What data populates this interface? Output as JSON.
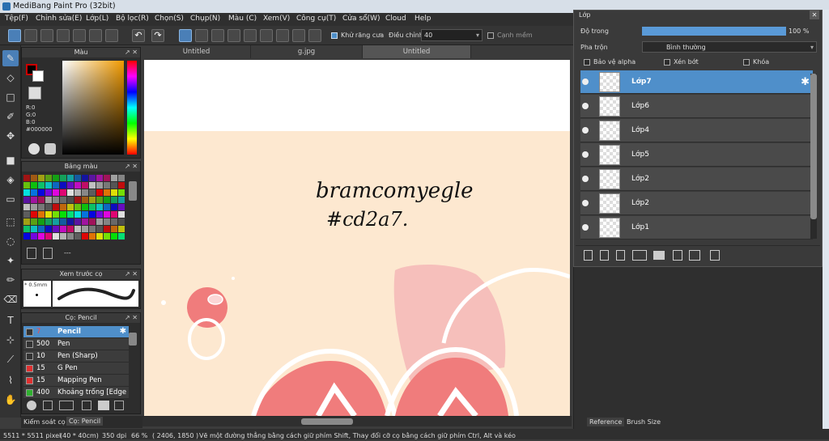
{
  "window": {
    "title": "MediBang Paint Pro (32bit)"
  },
  "menu": [
    "Tệp(F)",
    "Chỉnh sửa(E)",
    "Lớp(L)",
    "Bộ lọc(R)",
    "Chọn(S)",
    "Chụp(N)",
    "Màu (C)",
    "Xem(V)",
    "Công cụ(T)",
    "Cửa sổ(W)",
    "Cloud",
    "Help"
  ],
  "toolbar": {
    "antialias_label": "Khử răng cưa",
    "adjust_label": "Điều chỉnh",
    "adjust_value": "40",
    "snap_label": "Cạnh mềm"
  },
  "color_panel": {
    "title": "Màu",
    "r": "R:0",
    "g": "G:0",
    "b": "B:0",
    "hex": "#000000"
  },
  "palette_panel": {
    "title": "Bảng màu",
    "extra": "---"
  },
  "brush_preview": {
    "title": "Xem trước cọ",
    "size": "* 0.5mm"
  },
  "brush_panel": {
    "title": "Cọ: Pencil",
    "items": [
      {
        "size": "7",
        "name": "Pencil",
        "color": "#333333",
        "selected": true
      },
      {
        "size": "500",
        "name": "Pen",
        "color": "#333333"
      },
      {
        "size": "10",
        "name": "Pen (Sharp)",
        "color": "#333333"
      },
      {
        "size": "15",
        "name": "G Pen",
        "color": "#e03030"
      },
      {
        "size": "15",
        "name": "Mapping Pen",
        "color": "#e03030"
      },
      {
        "size": "400",
        "name": "Khoảng trống [Edge I",
        "color": "#30b030"
      }
    ]
  },
  "bottom_tabs": [
    "Kiểm soát cọ",
    "Cọ: Pencil"
  ],
  "doc_tabs": [
    "Untitled",
    "g.jpg",
    "Untitled"
  ],
  "canvas": {
    "handwriting_line1": "bramcomyegle",
    "handwriting_line2": "#cd2a7."
  },
  "layer_panel": {
    "title": "Lớp",
    "opacity_label": "Độ trong",
    "opacity_value": "100 %",
    "opacity_fraction": 1.0,
    "blend_label": "Pha trộn",
    "blend_value": "Bình thường",
    "protect_alpha": "Bảo vệ alpha",
    "clipping": "Xén bớt",
    "lock": "Khóa",
    "layers": [
      {
        "name": "Lớp7",
        "selected": true
      },
      {
        "name": "Lớp6"
      },
      {
        "name": "Lớp4"
      },
      {
        "name": "Lớp5"
      },
      {
        "name": "Lớp2"
      },
      {
        "name": "Lớp2"
      },
      {
        "name": "Lớp1"
      }
    ]
  },
  "right_tabs": [
    "Reference",
    "Brush Size"
  ],
  "status": {
    "dims": "5511 * 5511 pixel",
    "cm": "(40 * 40cm)",
    "dpi": "350 dpi",
    "zoom": "66 %",
    "coord": "( 2406, 1850 )",
    "hint": "Vẽ một đường thẳng bằng cách giữ phím Shift, Thay đổi cỡ cọ bằng cách giữ phím Ctrl, Alt và kéo"
  },
  "colors": {
    "accent": "#4f8fca",
    "canvas_bg": "#fde8d0",
    "pink": "#f28b8b"
  }
}
